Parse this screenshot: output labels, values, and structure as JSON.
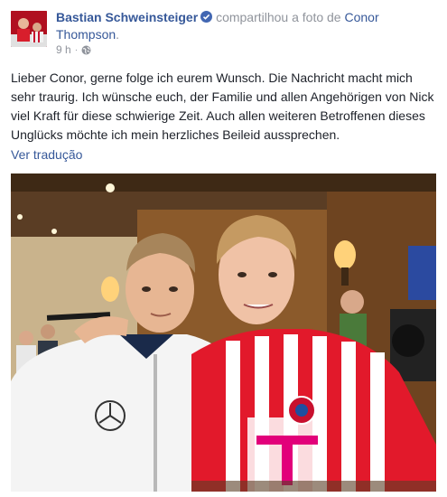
{
  "post": {
    "author": "Bastian Schweinsteiger",
    "action": "compartilhou a foto de",
    "target": "Conor Thompson",
    "target_suffix": ".",
    "time": "9 h",
    "separator": "·",
    "text": "Lieber Conor, gerne folge ich eurem Wunsch. Die Nachricht macht mich sehr traurig. Ich wünsche euch, der Familie und allen Angehörigen von Nick viel Kraft für diese schwierige Zeit. Auch allen weiteren Betroffenen dieses Unglücks möchte ich mein herzliches Beileid aussprechen.",
    "translate_link": "Ver tradução"
  },
  "icons": {
    "verified": "verified-badge-icon",
    "privacy": "globe-icon"
  },
  "colors": {
    "link": "#365899",
    "muted": "#90949c",
    "text": "#1d2129",
    "verified": "#4267b2"
  }
}
